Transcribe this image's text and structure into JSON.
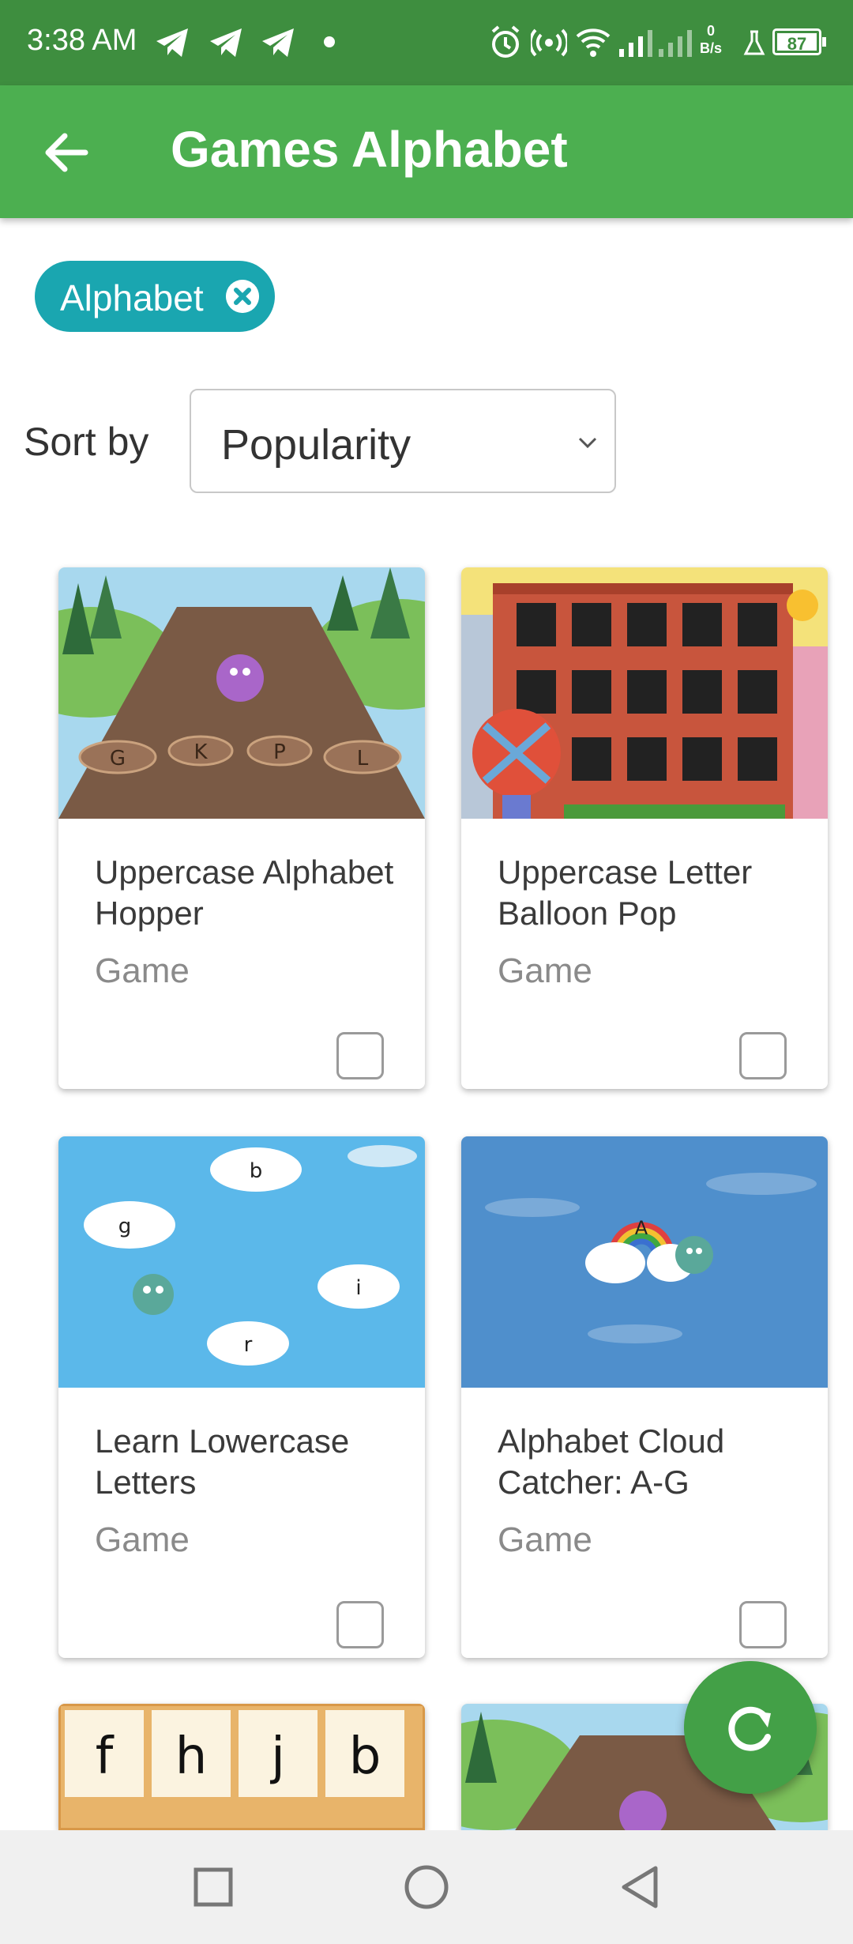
{
  "status_bar": {
    "time": "3:38 AM",
    "net_speed_value": "0",
    "net_speed_unit": "B/s",
    "battery": "87"
  },
  "app_bar": {
    "title": "Games Alphabet",
    "back_icon": "arrow-left-icon"
  },
  "filters": {
    "chips": [
      {
        "label": "Alphabet",
        "remove_icon": "close-circle-icon"
      }
    ]
  },
  "sort": {
    "label": "Sort by",
    "selected": "Popularity"
  },
  "cards": [
    {
      "title": "Uppercase Alphabet Hopper",
      "type": "Game",
      "thumb": "hopper-game-thumbnail",
      "checked": false
    },
    {
      "title": "Uppercase Letter Balloon Pop",
      "type": "Game",
      "thumb": "balloon-pop-thumbnail",
      "checked": false
    },
    {
      "title": "Learn Lowercase Letters",
      "type": "Game",
      "thumb": "lowercase-clouds-thumbnail",
      "checked": false
    },
    {
      "title": "Alphabet Cloud Catcher: A-G",
      "type": "Game",
      "thumb": "cloud-catcher-thumbnail",
      "checked": false
    }
  ],
  "thumb_letters": {
    "hopper": [
      "G",
      "K",
      "P",
      "L"
    ],
    "clouds": [
      "b",
      "g",
      "i",
      "r"
    ],
    "rainbow": "A",
    "tiles": [
      "f",
      "h",
      "j",
      "b"
    ]
  },
  "fab": {
    "icon": "refresh-icon"
  },
  "nav": {
    "buttons": [
      "recents-icon",
      "home-icon",
      "back-icon"
    ]
  },
  "colors": {
    "status_bar": "#3e8e3f",
    "app_bar": "#4caf50",
    "chip": "#1aa6b0",
    "fab": "#43a047"
  }
}
